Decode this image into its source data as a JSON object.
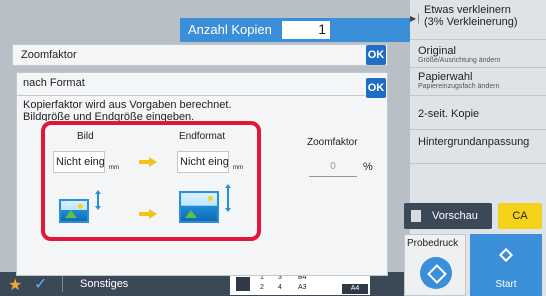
{
  "header": {
    "copies_label": "Anzahl Kopien",
    "copies_value": "1"
  },
  "right_panel": {
    "items": [
      {
        "title": "Etwas verkleinern",
        "sub": "(3% Verkleinerung)"
      },
      {
        "title": "Original",
        "sub": "Größe/Ausrichtung ändern"
      },
      {
        "title": "Papierwahl",
        "sub": "Papiereinzugsfach ändern"
      },
      {
        "title": "2-seit. Kopie",
        "sub": ""
      },
      {
        "title": "Hintergrundanpassung",
        "sub": ""
      }
    ],
    "preview_label": "Vorschau",
    "ca_label": "CA",
    "probedruck_label": "Probedruck",
    "start_label": "Start"
  },
  "dialog_zoom": {
    "title": "Zoomfaktor",
    "ok_label": "OK"
  },
  "dialog_format": {
    "title": "nach Format",
    "ok_label": "OK",
    "description": "Kopierfaktor wird aus Vorgaben berechnet. Bildgröße und Endgröße eingeben.",
    "bild_label": "Bild",
    "endformat_label": "Endformat",
    "bild_value": "Nicht eing",
    "endformat_value": "Nicht eing",
    "unit": "mm",
    "zoom_label": "Zoomfaktor",
    "zoom_placeholder": "0",
    "percent": "%"
  },
  "bottom_bar": {
    "sonstiges_label": "Sonstiges",
    "tray_numbers": [
      "1",
      "2",
      "3",
      "4"
    ],
    "tray_sizes": [
      "B4",
      "A3"
    ],
    "tray_selected": "A4"
  },
  "colors": {
    "accent": "#1e6fc4",
    "highlight": "#e2163a",
    "ca": "#f4d21a"
  }
}
